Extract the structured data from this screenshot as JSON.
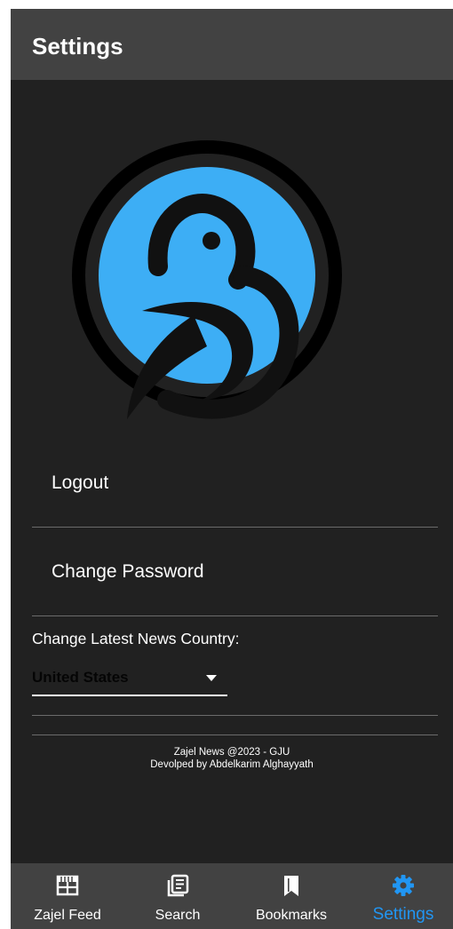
{
  "app_bar": {
    "title": "Settings"
  },
  "menu": {
    "logout": "Logout",
    "change_password": "Change Password"
  },
  "country": {
    "label": "Change Latest News Country:",
    "selected": "United States"
  },
  "footer": {
    "line1": "Zajel News @2023 - GJU",
    "line2": "Devolped by Abdelkarim Alghayyath"
  },
  "bottom_nav": {
    "feed": "Zajel Feed",
    "search": "Search",
    "bookmarks": "Bookmarks",
    "settings": "Settings",
    "active": "Settings"
  },
  "colors": {
    "background": "#212121",
    "bar": "#424242",
    "accent": "#2196f3",
    "logo_blue": "#3daef5"
  },
  "icons": {
    "logo": "bird-logo-icon",
    "feed": "calendar-feed-icon",
    "search": "newspaper-icon",
    "bookmarks": "bookmark-icon",
    "settings": "gear-icon"
  }
}
